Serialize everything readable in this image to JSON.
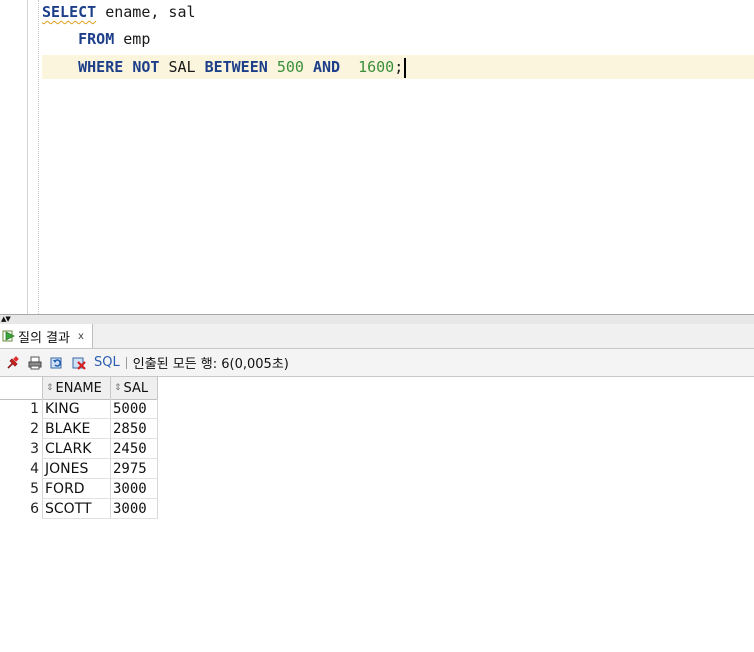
{
  "editor": {
    "line1": {
      "kw": "SELECT",
      "rest": " ename, sal"
    },
    "line2": {
      "kw": "FROM",
      "rest": " emp"
    },
    "line3": {
      "kw1": "WHERE",
      "kw2": "NOT",
      "col": "SAL",
      "kw3": "BETWEEN",
      "n1": "500",
      "kw4": "AND",
      "n2": "1600",
      "end": ";"
    }
  },
  "results_tab": {
    "label": "질의 결과",
    "close": "x"
  },
  "toolbar": {
    "sql_label": "SQL",
    "status": "인출된 모든 행: 6(0,005초)",
    "icons": [
      "pin-icon",
      "print-icon",
      "refresh-icon",
      "delete-icon"
    ]
  },
  "grid": {
    "columns": [
      "ENAME",
      "SAL"
    ],
    "rows": [
      {
        "num": "1",
        "ename": "KING",
        "sal": "5000"
      },
      {
        "num": "2",
        "ename": "BLAKE",
        "sal": "2850"
      },
      {
        "num": "3",
        "ename": "CLARK",
        "sal": "2450"
      },
      {
        "num": "4",
        "ename": "JONES",
        "sal": "2975"
      },
      {
        "num": "5",
        "ename": "FORD",
        "sal": "3000"
      },
      {
        "num": "6",
        "ename": "SCOTT",
        "sal": "3000"
      }
    ]
  },
  "colors": {
    "keyword": "#1d3f8a",
    "number": "#3a8f3a",
    "current_line": "#fbf5de",
    "sql_link": "#2a5db0"
  }
}
